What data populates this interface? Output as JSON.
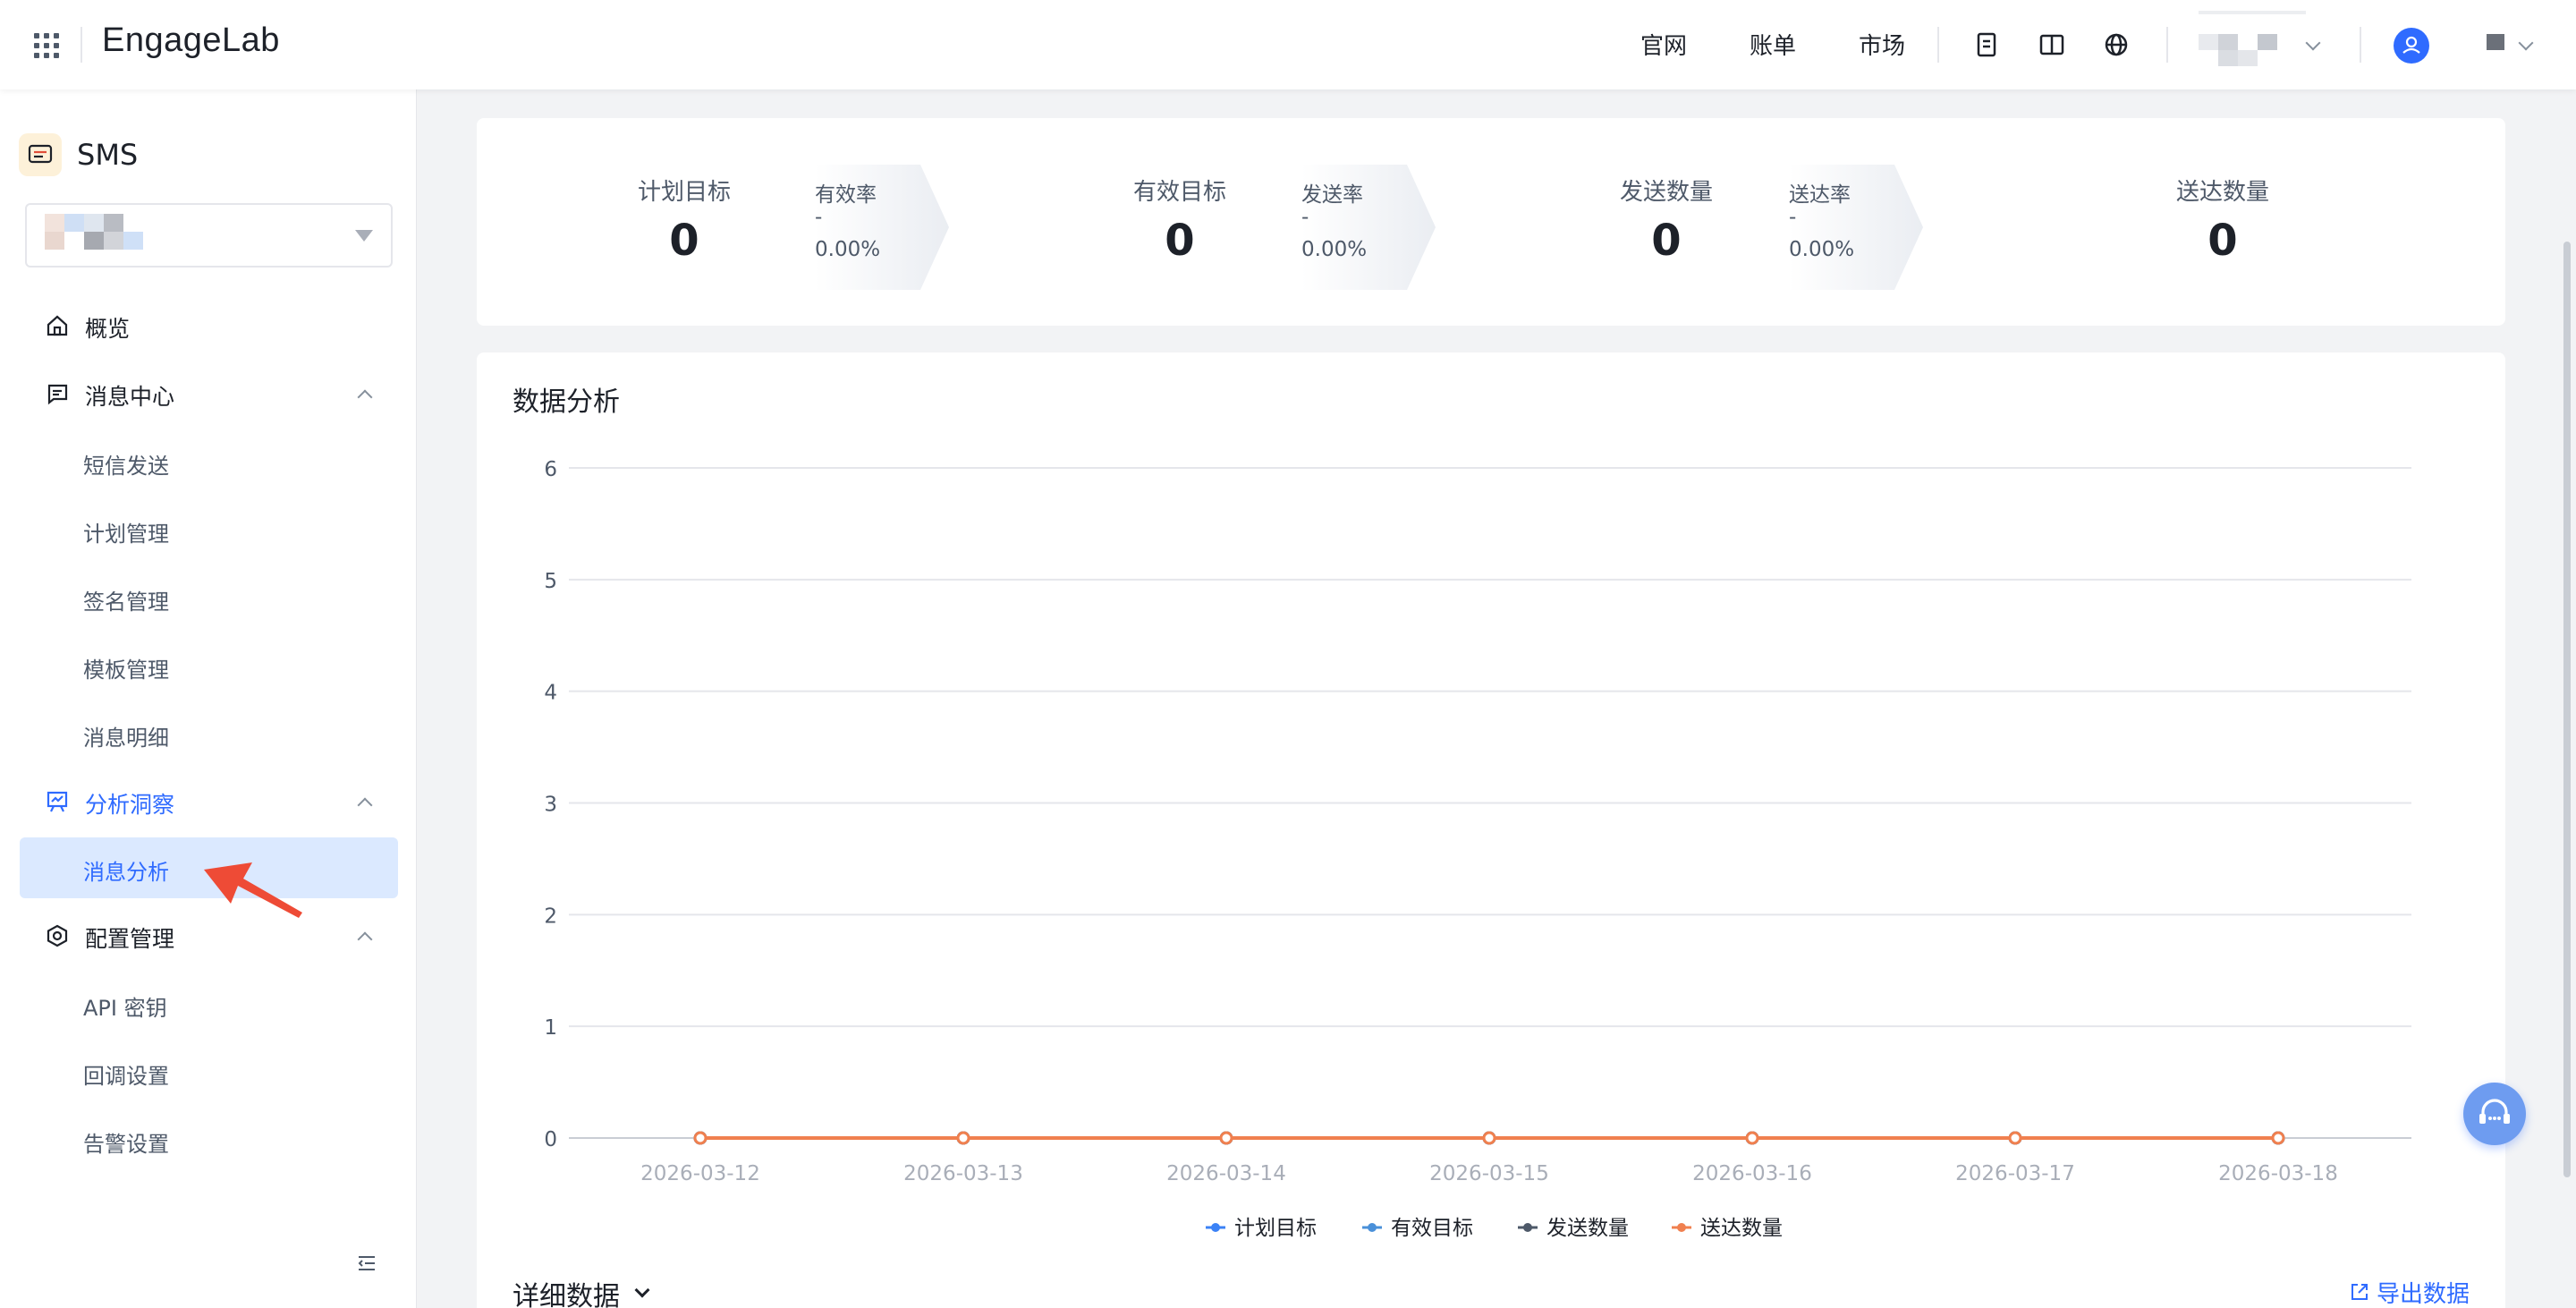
{
  "topbar": {
    "logo": "EngageLab",
    "nav": [
      "官网",
      "账单",
      "市场"
    ],
    "icons": [
      "grid-icon",
      "doc-icon",
      "book-icon",
      "globe-icon",
      "user-icon"
    ]
  },
  "sidebar": {
    "product": "SMS",
    "menu": [
      {
        "label": "概览",
        "icon": "home-icon"
      },
      {
        "label": "消息中心",
        "icon": "message-icon",
        "children": [
          "短信发送",
          "计划管理",
          "签名管理",
          "模板管理",
          "消息明细"
        ]
      },
      {
        "label": "分析洞察",
        "icon": "chart-icon",
        "children": [
          "消息分析"
        ]
      },
      {
        "label": "配置管理",
        "icon": "settings-icon",
        "children": [
          "API 密钥",
          "回调设置",
          "告警设置"
        ]
      }
    ],
    "active_item": "消息分析"
  },
  "stats": {
    "items": [
      {
        "name": "计划目标",
        "value": "0"
      },
      {
        "name": "有效目标",
        "value": "0"
      },
      {
        "name": "发送数量",
        "value": "0"
      },
      {
        "name": "送达数量",
        "value": "0"
      }
    ],
    "rates": [
      {
        "name": "有效率",
        "dash": "-",
        "value": "0.00%"
      },
      {
        "name": "发送率",
        "dash": "-",
        "value": "0.00%"
      },
      {
        "name": "送达率",
        "dash": "-",
        "value": "0.00%"
      }
    ]
  },
  "analysis": {
    "title": "数据分析",
    "detail_title": "详细数据",
    "export_label": "导出数据"
  },
  "chart_data": {
    "type": "line",
    "x": [
      "2026-03-12",
      "2026-03-13",
      "2026-03-14",
      "2026-03-15",
      "2026-03-16",
      "2026-03-17",
      "2026-03-18"
    ],
    "ylim": [
      0,
      6
    ],
    "yticks": [
      "0",
      "1",
      "2",
      "3",
      "4",
      "5",
      "6"
    ],
    "grid": true,
    "legend_position": "bottom",
    "series": [
      {
        "name": "计划目标",
        "values": [
          0,
          0,
          0,
          0,
          0,
          0,
          0
        ],
        "color": "#3b82f6"
      },
      {
        "name": "有效目标",
        "values": [
          0,
          0,
          0,
          0,
          0,
          0,
          0
        ],
        "color": "#4a90d9"
      },
      {
        "name": "发送数量",
        "values": [
          0,
          0,
          0,
          0,
          0,
          0,
          0
        ],
        "color": "#4e5969"
      },
      {
        "name": "送达数量",
        "values": [
          0,
          0,
          0,
          0,
          0,
          0,
          0
        ],
        "color": "#f0804f"
      }
    ]
  }
}
